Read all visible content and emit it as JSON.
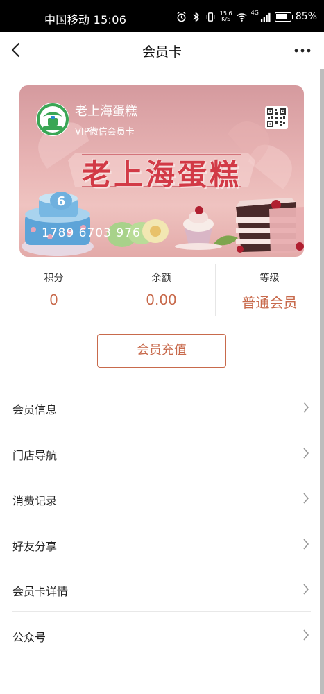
{
  "status_bar": {
    "carrier_time": "中国移动 15:06",
    "speed_value": "15.6",
    "speed_unit": "K/S",
    "battery_level": 0.85,
    "battery": "85%",
    "network": "4G"
  },
  "nav": {
    "title": "会员卡"
  },
  "card": {
    "store_name": "老上海蛋糕",
    "card_type": "VIP微信会员卡",
    "brand_banner": "老上海蛋糕",
    "card_number": "1789 6703 976",
    "cake_topper": "6"
  },
  "stats": [
    {
      "label": "积分",
      "value": "0"
    },
    {
      "label": "余额",
      "value": "0.00"
    },
    {
      "label": "等级",
      "value": "普通会员"
    }
  ],
  "recharge_label": "会员充值",
  "menu": [
    {
      "label": "会员信息"
    },
    {
      "label": "门店导航"
    },
    {
      "label": "消费记录"
    },
    {
      "label": "好友分享"
    },
    {
      "label": "会员卡详情"
    },
    {
      "label": "公众号"
    }
  ],
  "colors": {
    "accent": "#c86a4c",
    "card_brand": "#d23a46",
    "logo_green": "#3aa655"
  }
}
